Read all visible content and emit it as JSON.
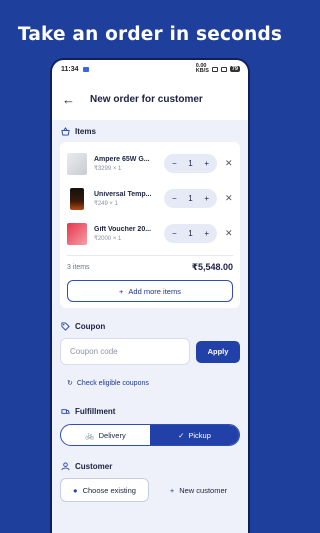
{
  "headline": "Take an order in seconds",
  "status": {
    "time": "11:34",
    "speed": "0.00\nKB/S",
    "battery": "79"
  },
  "appbar": {
    "title": "New order for customer"
  },
  "items": {
    "heading": "Items",
    "list": [
      {
        "name": "Ampere 65W G...",
        "price": "₹3299 × 1",
        "qty": "1"
      },
      {
        "name": "Universal Temp...",
        "price": "₹249 × 1",
        "qty": "1"
      },
      {
        "name": "Gift Voucher 20...",
        "price": "₹2000 × 1",
        "qty": "1"
      }
    ],
    "count_label": "3 items",
    "total": "₹5,548.00",
    "add_more": "Add more items"
  },
  "coupon": {
    "heading": "Coupon",
    "placeholder": "Coupon code",
    "apply": "Apply",
    "check": "Check eligible coupons"
  },
  "fulfillment": {
    "heading": "Fulfillment",
    "options": [
      "Delivery",
      "Pickup"
    ],
    "selected": "Pickup"
  },
  "customer": {
    "heading": "Customer",
    "choose": "Choose existing",
    "new": "New customer"
  },
  "colors": {
    "brand": "#1f3f9c",
    "accent": "#2141a8",
    "screen": "#eef1fa"
  }
}
